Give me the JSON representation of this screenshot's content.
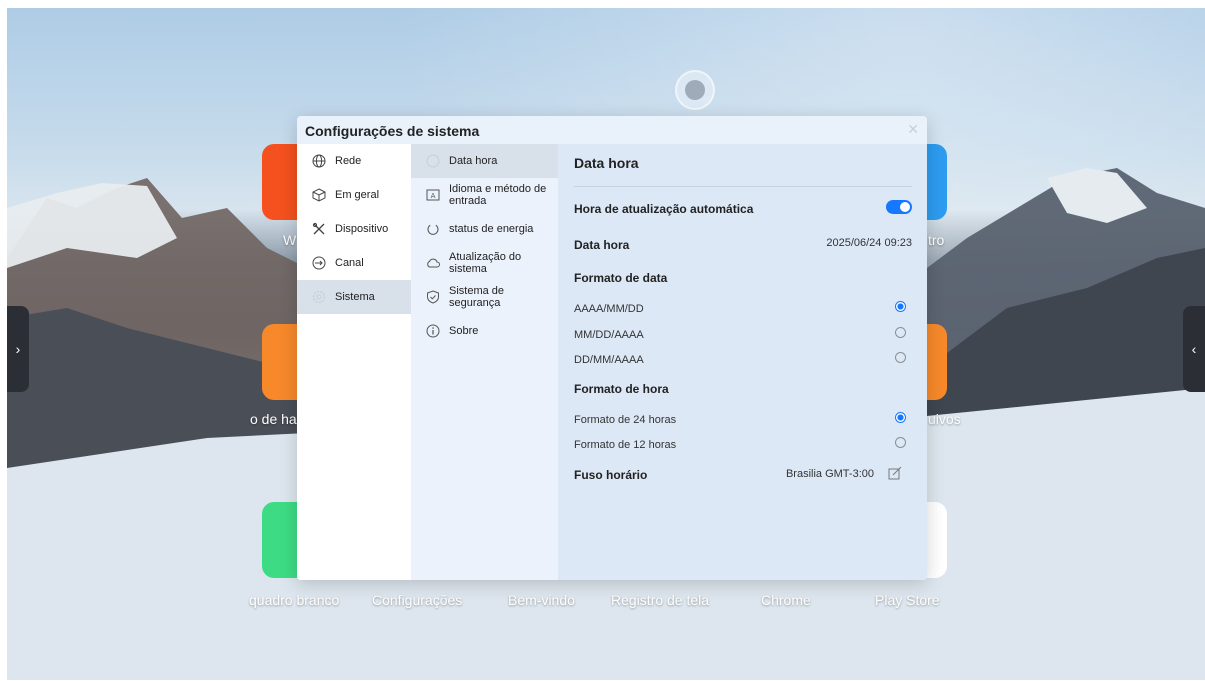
{
  "dialog": {
    "title": "Configurações de sistema",
    "close_icon": "close-icon"
  },
  "categories": [
    {
      "label": "Rede",
      "icon": "globe-icon",
      "selected": false
    },
    {
      "label": "Em geral",
      "icon": "cube-icon",
      "selected": false
    },
    {
      "label": "Dispositivo",
      "icon": "tools-icon",
      "selected": false
    },
    {
      "label": "Canal",
      "icon": "input-icon",
      "selected": false
    },
    {
      "label": "Sistema",
      "icon": "gear-icon",
      "selected": true
    }
  ],
  "subcategories": [
    {
      "label": "Data hora",
      "icon": "clock-icon",
      "selected": true
    },
    {
      "label": "Idioma e método de entrada",
      "icon": "keyboard-icon",
      "selected": false
    },
    {
      "label": "status de energia",
      "icon": "power-icon",
      "selected": false
    },
    {
      "label": "Atualização do sistema",
      "icon": "cloud-icon",
      "selected": false
    },
    {
      "label": "Sistema de segurança",
      "icon": "shield-icon",
      "selected": false
    },
    {
      "label": "Sobre",
      "icon": "info-icon",
      "selected": false
    }
  ],
  "panel": {
    "heading": "Data hora",
    "auto_update_label": "Hora de atualização automática",
    "auto_update_on": true,
    "datetime_label": "Data hora",
    "datetime_value": "2025/06/24 09:23",
    "date_format_title": "Formato de data",
    "date_formats": [
      {
        "label": "AAAA/MM/DD",
        "selected": true
      },
      {
        "label": "MM/DD/AAAA",
        "selected": false
      },
      {
        "label": "DD/MM/AAAA",
        "selected": false
      }
    ],
    "time_format_title": "Formato de hora",
    "time_formats": [
      {
        "label": "Formato de 24 horas",
        "selected": true
      },
      {
        "label": "Formato de 12 horas",
        "selected": false
      }
    ],
    "timezone_label": "Fuso horário",
    "timezone_value": "Brasilia GMT-3:00"
  },
  "desktop": {
    "partial_labels": {
      "left_top": "W",
      "right_top": "tro",
      "left_mid": "o de ha",
      "right_mid": "uivos"
    },
    "dock_labels": [
      "quadro branco",
      "Configurações",
      "Bem-vindo",
      "Registro de tela",
      "Chrome",
      "Play Store"
    ],
    "colors": {
      "accent": "#1677ff",
      "tile_red": "#f4511e",
      "tile_orange": "#f7892b",
      "tile_blue": "#2d9cf0",
      "tile_green": "#3ddc84"
    }
  }
}
